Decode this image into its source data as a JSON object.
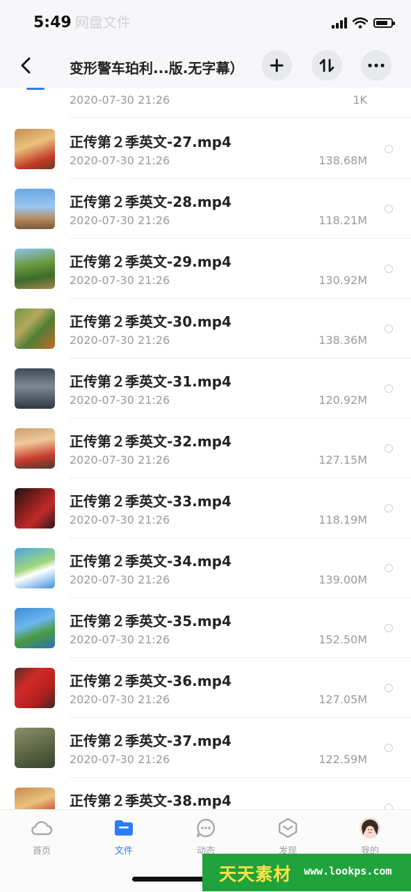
{
  "status_bar": {
    "time": "5:49",
    "ghost_text": "网盘文件"
  },
  "nav": {
    "title": "变形警车珀利...版.无字幕）",
    "back_icon": "chevron-left-icon",
    "add_icon": "plus-icon",
    "sort_icon": "sort-arrows-icon",
    "more_icon": "more-dots-icon"
  },
  "files": [
    {
      "name": "",
      "date": "2020-07-30 21:26",
      "size": "1K"
    },
    {
      "name": "正传第２季英文-27.mp4",
      "date": "2020-07-30 21:26",
      "size": "138.68M"
    },
    {
      "name": "正传第２季英文-28.mp4",
      "date": "2020-07-30 21:26",
      "size": "118.21M"
    },
    {
      "name": "正传第２季英文-29.mp4",
      "date": "2020-07-30 21:26",
      "size": "130.92M"
    },
    {
      "name": "正传第２季英文-30.mp4",
      "date": "2020-07-30 21:26",
      "size": "138.36M"
    },
    {
      "name": "正传第２季英文-31.mp4",
      "date": "2020-07-30 21:26",
      "size": "120.92M"
    },
    {
      "name": "正传第２季英文-32.mp4",
      "date": "2020-07-30 21:26",
      "size": "127.15M"
    },
    {
      "name": "正传第２季英文-33.mp4",
      "date": "2020-07-30 21:26",
      "size": "118.19M"
    },
    {
      "name": "正传第２季英文-34.mp4",
      "date": "2020-07-30 21:26",
      "size": "139.00M"
    },
    {
      "name": "正传第２季英文-35.mp4",
      "date": "2020-07-30 21:26",
      "size": "152.50M"
    },
    {
      "name": "正传第２季英文-36.mp4",
      "date": "2020-07-30 21:26",
      "size": "127.05M"
    },
    {
      "name": "正传第２季英文-37.mp4",
      "date": "2020-07-30 21:26",
      "size": "122.59M"
    },
    {
      "name": "正传第２季英文-38.mp4",
      "date": "",
      "size": ""
    }
  ],
  "tabs": [
    {
      "label": "首页",
      "icon": "cloud-home-icon"
    },
    {
      "label": "文件",
      "icon": "folder-icon",
      "active": true
    },
    {
      "label": "动态",
      "icon": "chat-bubble-icon"
    },
    {
      "label": "发现",
      "icon": "discover-icon"
    },
    {
      "label": "我的",
      "icon": "avatar"
    }
  ],
  "watermark": {
    "logo": "天天素材",
    "url": "www.lookps.com"
  },
  "colors": {
    "accent": "#2b7cf6",
    "watermark_bg": "#1fa33a",
    "text_secondary": "#9a9aa0"
  }
}
